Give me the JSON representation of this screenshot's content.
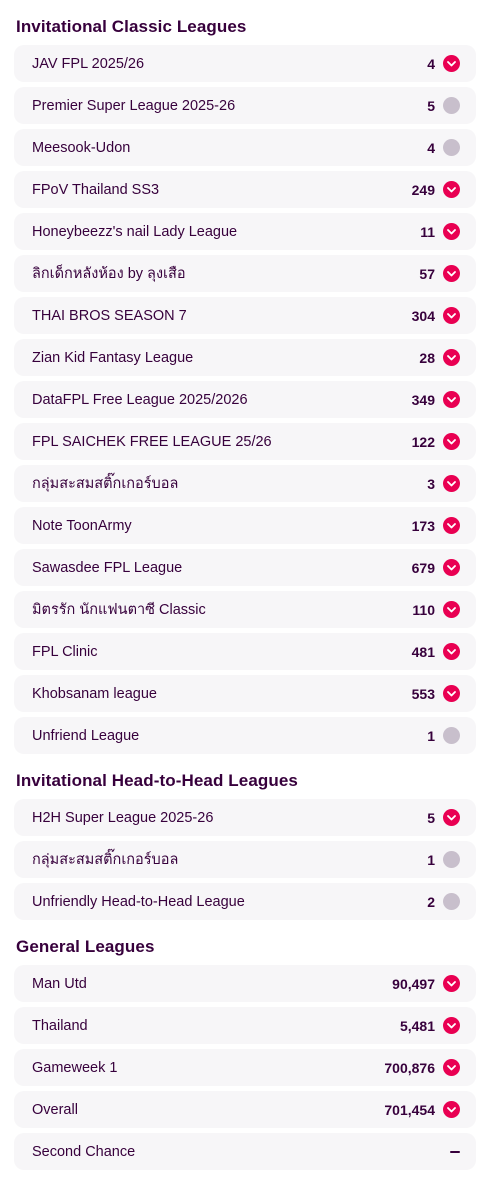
{
  "sections": [
    {
      "title": "Invitational Classic Leagues",
      "leagues": [
        {
          "name": "JAV FPL 2025/26",
          "rank": "4",
          "movement": "down"
        },
        {
          "name": "Premier Super League 2025-26",
          "rank": "5",
          "movement": "same"
        },
        {
          "name": "Meesook-Udon",
          "rank": "4",
          "movement": "same"
        },
        {
          "name": "FPoV Thailand SS3",
          "rank": "249",
          "movement": "down"
        },
        {
          "name": "Honeybeezz's nail Lady League",
          "rank": "11",
          "movement": "down"
        },
        {
          "name": "ลิกเด็กหลังห้อง by ลุงเสือ",
          "rank": "57",
          "movement": "down"
        },
        {
          "name": "THAI BROS SEASON 7",
          "rank": "304",
          "movement": "down"
        },
        {
          "name": "Zian Kid Fantasy League",
          "rank": "28",
          "movement": "down"
        },
        {
          "name": "DataFPL Free League 2025/2026",
          "rank": "349",
          "movement": "down"
        },
        {
          "name": "FPL SAICHEK FREE LEAGUE 25/26",
          "rank": "122",
          "movement": "down"
        },
        {
          "name": "กลุ่มสะสมสติ๊กเกอร์บอล",
          "rank": "3",
          "movement": "down"
        },
        {
          "name": "Note ToonArmy",
          "rank": "173",
          "movement": "down"
        },
        {
          "name": "Sawasdee FPL League",
          "rank": "679",
          "movement": "down"
        },
        {
          "name": "มิตรรัก นักแฟนตาซี Classic",
          "rank": "110",
          "movement": "down"
        },
        {
          "name": "FPL Clinic",
          "rank": "481",
          "movement": "down"
        },
        {
          "name": "Khobsanam league",
          "rank": "553",
          "movement": "down"
        },
        {
          "name": "Unfriend League",
          "rank": "1",
          "movement": "same"
        }
      ]
    },
    {
      "title": "Invitational Head-to-Head Leagues",
      "leagues": [
        {
          "name": "H2H Super League 2025-26",
          "rank": "5",
          "movement": "down"
        },
        {
          "name": "กลุ่มสะสมสติ๊กเกอร์บอล",
          "rank": "1",
          "movement": "same"
        },
        {
          "name": "Unfriendly Head-to-Head League",
          "rank": "2",
          "movement": "same"
        }
      ]
    },
    {
      "title": "General Leagues",
      "leagues": [
        {
          "name": "Man Utd",
          "rank": "90,497",
          "movement": "down"
        },
        {
          "name": "Thailand",
          "rank": "5,481",
          "movement": "down"
        },
        {
          "name": "Gameweek 1",
          "rank": "700,876",
          "movement": "down"
        },
        {
          "name": "Overall",
          "rank": "701,454",
          "movement": "down"
        },
        {
          "name": "Second Chance",
          "rank": "",
          "movement": "none"
        }
      ]
    }
  ],
  "colors": {
    "brand_purple": "#37003c",
    "movement_down": "#e90052",
    "movement_same": "#c8bfcc",
    "row_bg": "#f7f6f8"
  },
  "icons": {
    "down": "chevron-down-icon",
    "same": "no-change-dot-icon",
    "none": "dash-icon"
  }
}
